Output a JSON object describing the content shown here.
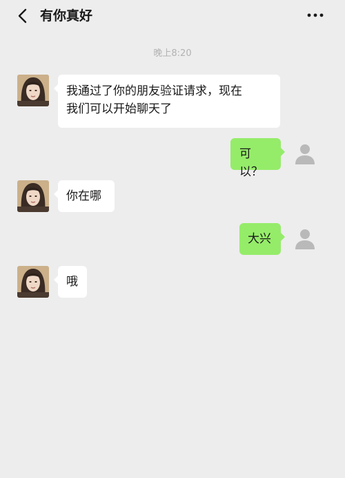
{
  "header": {
    "title": "有你真好",
    "back_icon": "chevron-left-icon",
    "more_icon": "more-dots-icon"
  },
  "timestamp": "晚上8:20",
  "messages": [
    {
      "side": "in",
      "text": "我通过了你的朋友验证请求，现在\n我们可以开始聊天了"
    },
    {
      "side": "out",
      "text": "可以？"
    },
    {
      "side": "in",
      "text": "你在哪"
    },
    {
      "side": "out",
      "text": "大兴"
    },
    {
      "side": "in",
      "text": "哦"
    }
  ],
  "colors": {
    "background": "#ededed",
    "incoming_bubble": "#ffffff",
    "outgoing_bubble": "#95ec69",
    "timestamp": "#b2b2b2"
  }
}
